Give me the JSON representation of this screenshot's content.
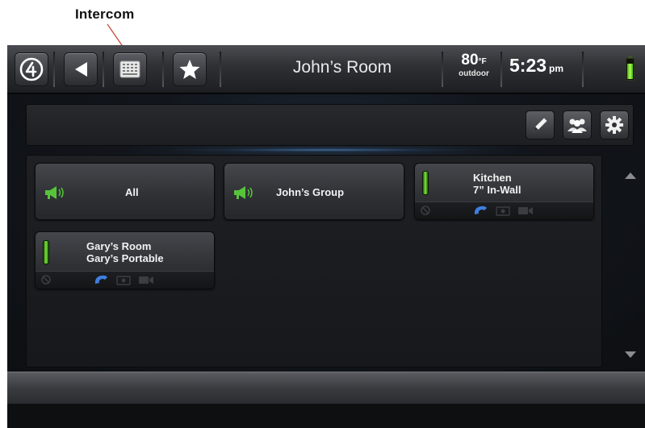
{
  "annotation": {
    "label": "Intercom"
  },
  "topbar": {
    "room_title": "John’s Room",
    "temperature": {
      "value": "80",
      "unit": "°F",
      "label": "outdoor"
    },
    "time": {
      "value": "5:23",
      "ampm": "pm"
    },
    "battery_level_percent": 80,
    "icons": [
      "control4-logo-icon",
      "back-arrow-icon",
      "intercom-keypad-icon",
      "star-icon"
    ]
  },
  "toolbar": {
    "icons": [
      "pencil-icon",
      "people-group-icon",
      "gear-icon"
    ]
  },
  "intercom_cards": [
    {
      "type": "group",
      "label_line1": "All",
      "label_line2": ""
    },
    {
      "type": "group",
      "label_line1": "John’s Group",
      "label_line2": ""
    },
    {
      "type": "device",
      "label_line1": "Kitchen",
      "label_line2": "7” In-Wall",
      "status": "online"
    },
    {
      "type": "device",
      "label_line1": "Gary’s Room",
      "label_line2": "Gary’s Portable",
      "status": "online"
    }
  ],
  "colors": {
    "status_green": "#7ce83b",
    "call_blue": "#3f7fe0",
    "megaphone_green": "#56c43a",
    "battery_green": "#a6ff52"
  }
}
